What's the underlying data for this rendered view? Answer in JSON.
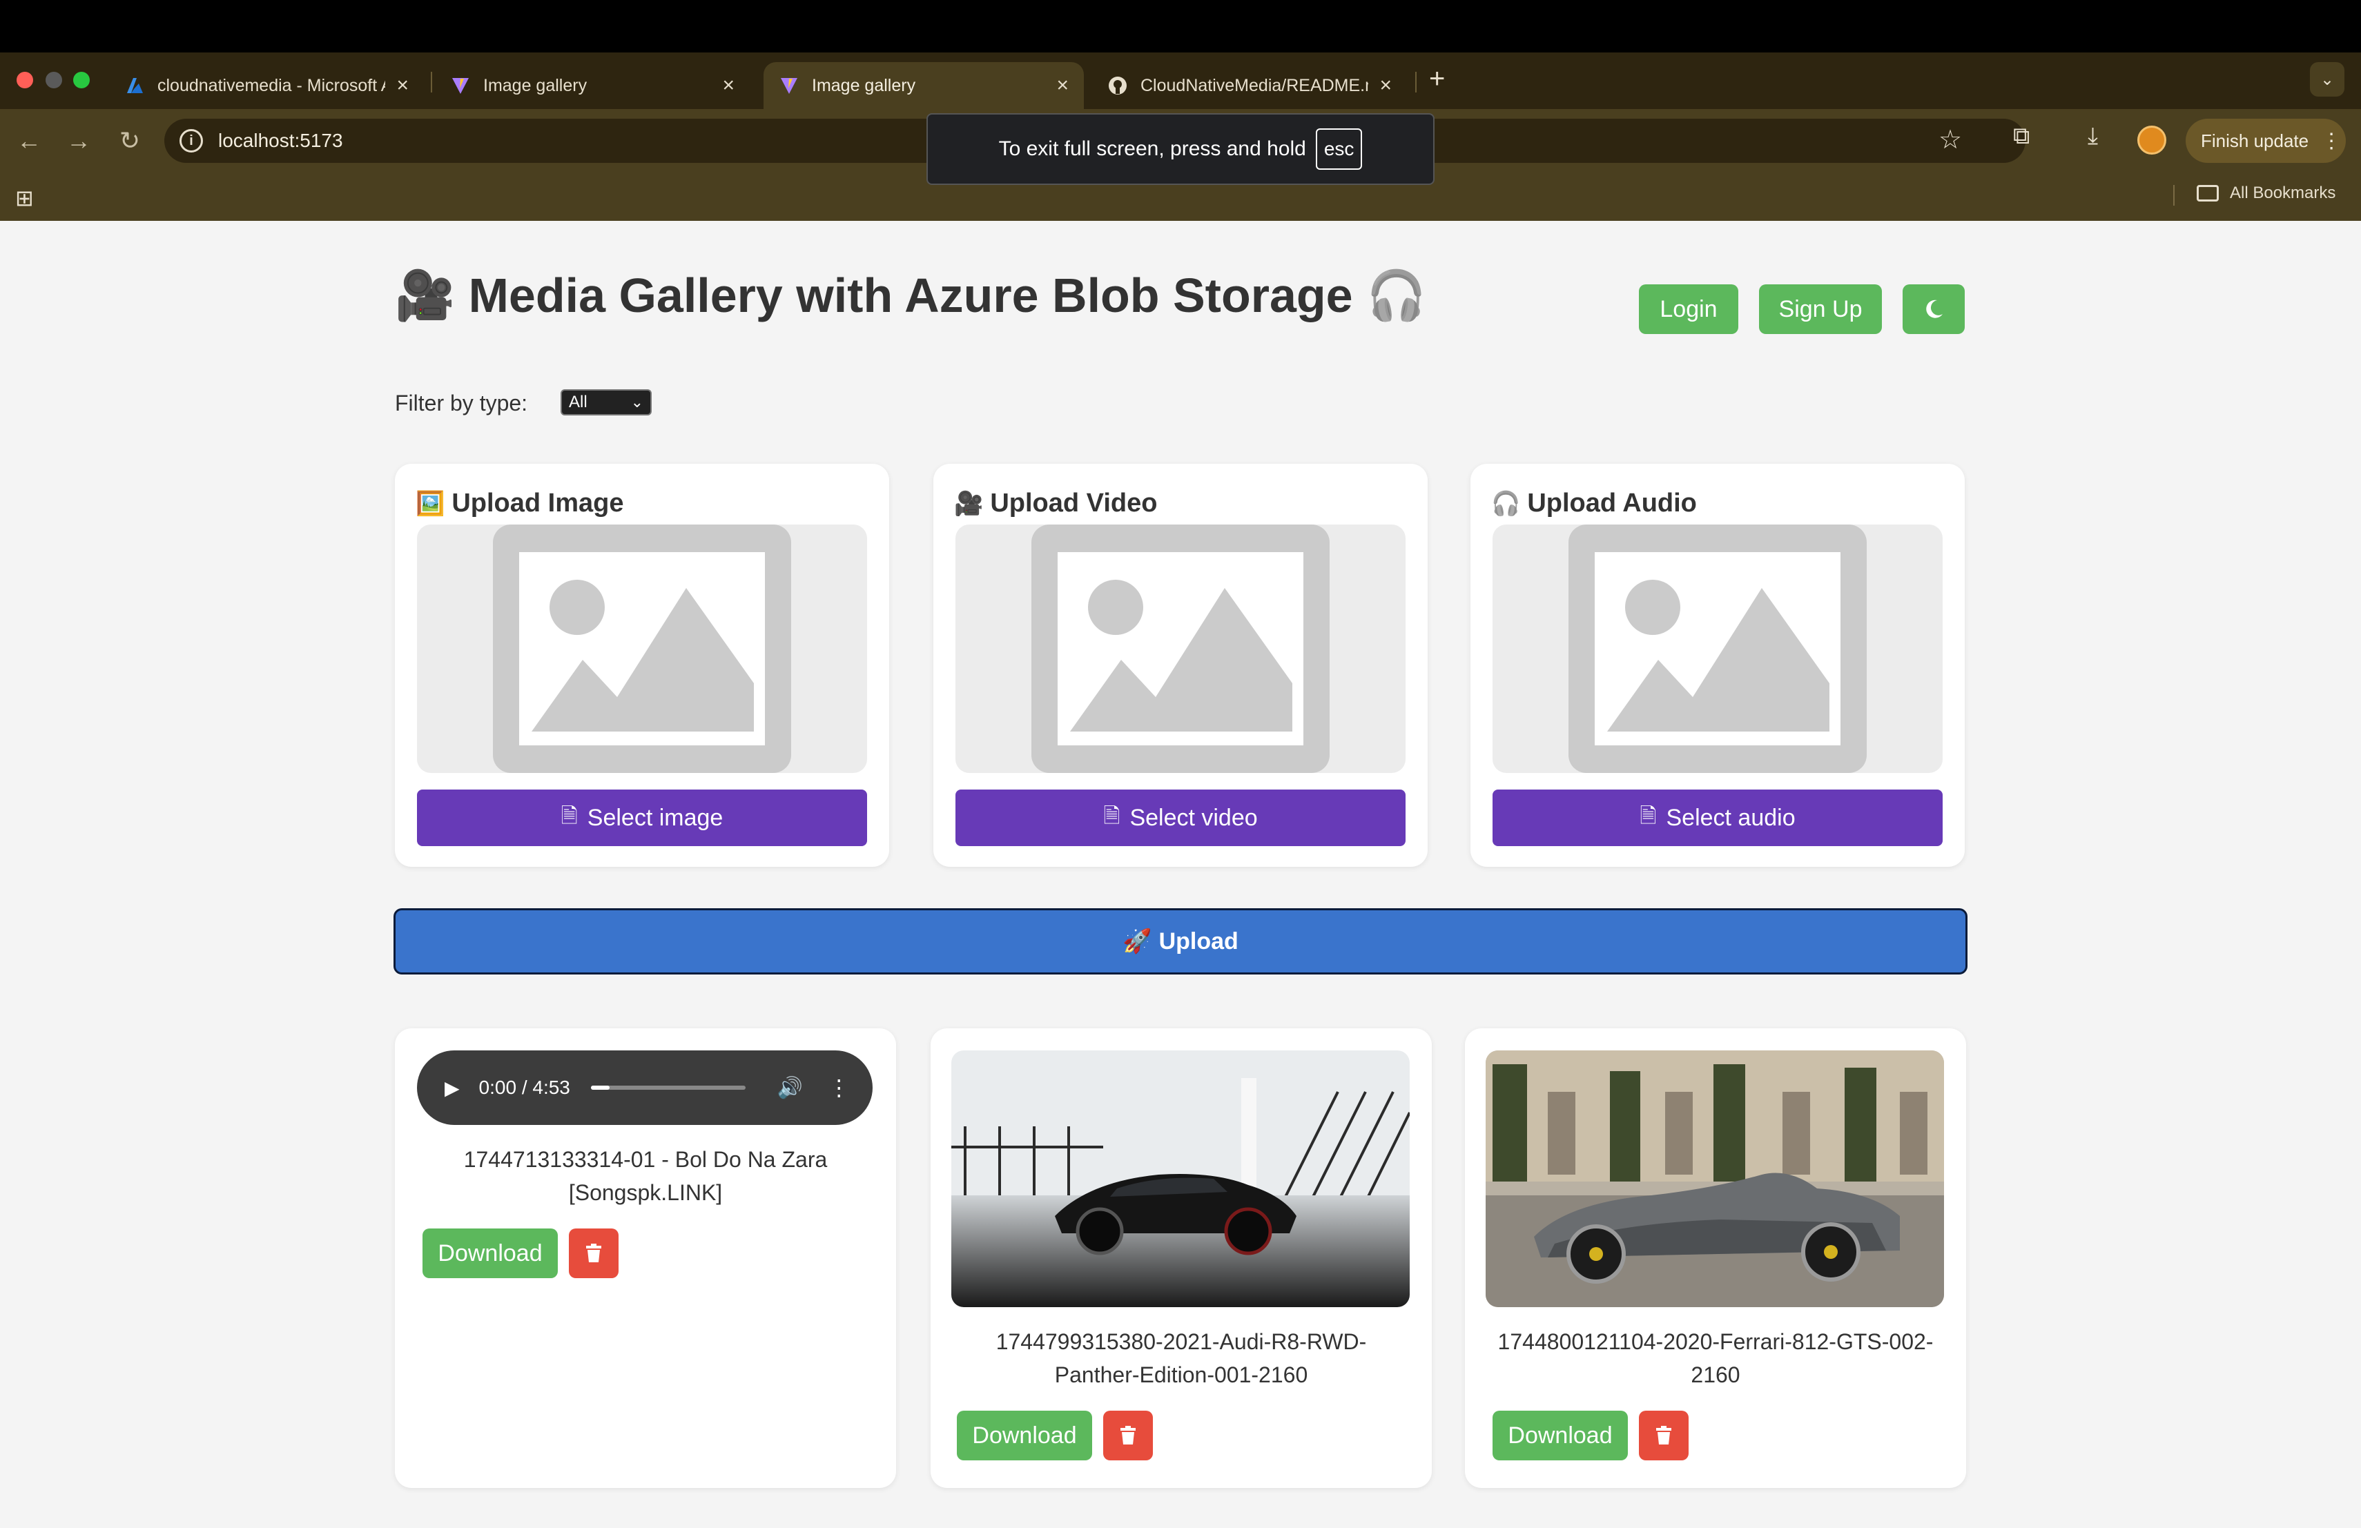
{
  "browser": {
    "tabs": [
      {
        "label": "cloudnativemedia - Microsoft Azure",
        "icon": "azure-icon"
      },
      {
        "label": "Image gallery",
        "icon": "vite-icon"
      },
      {
        "label": "Image gallery",
        "icon": "vite-icon",
        "active": true
      },
      {
        "label": "CloudNativeMedia/README.md",
        "icon": "github-icon"
      }
    ],
    "url": "localhost:5173",
    "finish_update": "Finish update",
    "all_bookmarks": "All Bookmarks",
    "fullscreen_toast": "To exit full screen, press and hold",
    "fullscreen_key": "esc"
  },
  "header": {
    "title": "Media Gallery with Azure Blob Storage",
    "title_emoji_left": "🎥",
    "title_emoji_right": "🎧",
    "login": "Login",
    "signup": "Sign Up",
    "theme_icon": "moon-icon"
  },
  "filter": {
    "label": "Filter by type:",
    "selected": "All"
  },
  "upload_cards": [
    {
      "emoji": "🖼️",
      "title": "Upload Image",
      "button": "Select image"
    },
    {
      "emoji": "🎥",
      "title": "Upload Video",
      "button": "Select video"
    },
    {
      "emoji": "🎧",
      "title": "Upload Audio",
      "button": "Select audio"
    }
  ],
  "upload_button": {
    "emoji": "🚀",
    "label": "Upload"
  },
  "media": [
    {
      "type": "audio",
      "time": "0:00 / 4:53",
      "progress": 0.12,
      "name": "1744713133314-01 - Bol Do Na Zara [Songspk.LINK]",
      "download": "Download"
    },
    {
      "type": "image",
      "name": "1744799315380-2021-Audi-R8-RWD-Panther-Edition-001-2160",
      "download": "Download"
    },
    {
      "type": "image",
      "name": "1744800121104-2020-Ferrari-812-GTS-002-2160",
      "download": "Download"
    }
  ],
  "colors": {
    "accent_green": "#5cb85c",
    "select_purple": "#673ab7",
    "upload_blue": "#3a74cc",
    "delete_red": "#e74c3c"
  }
}
